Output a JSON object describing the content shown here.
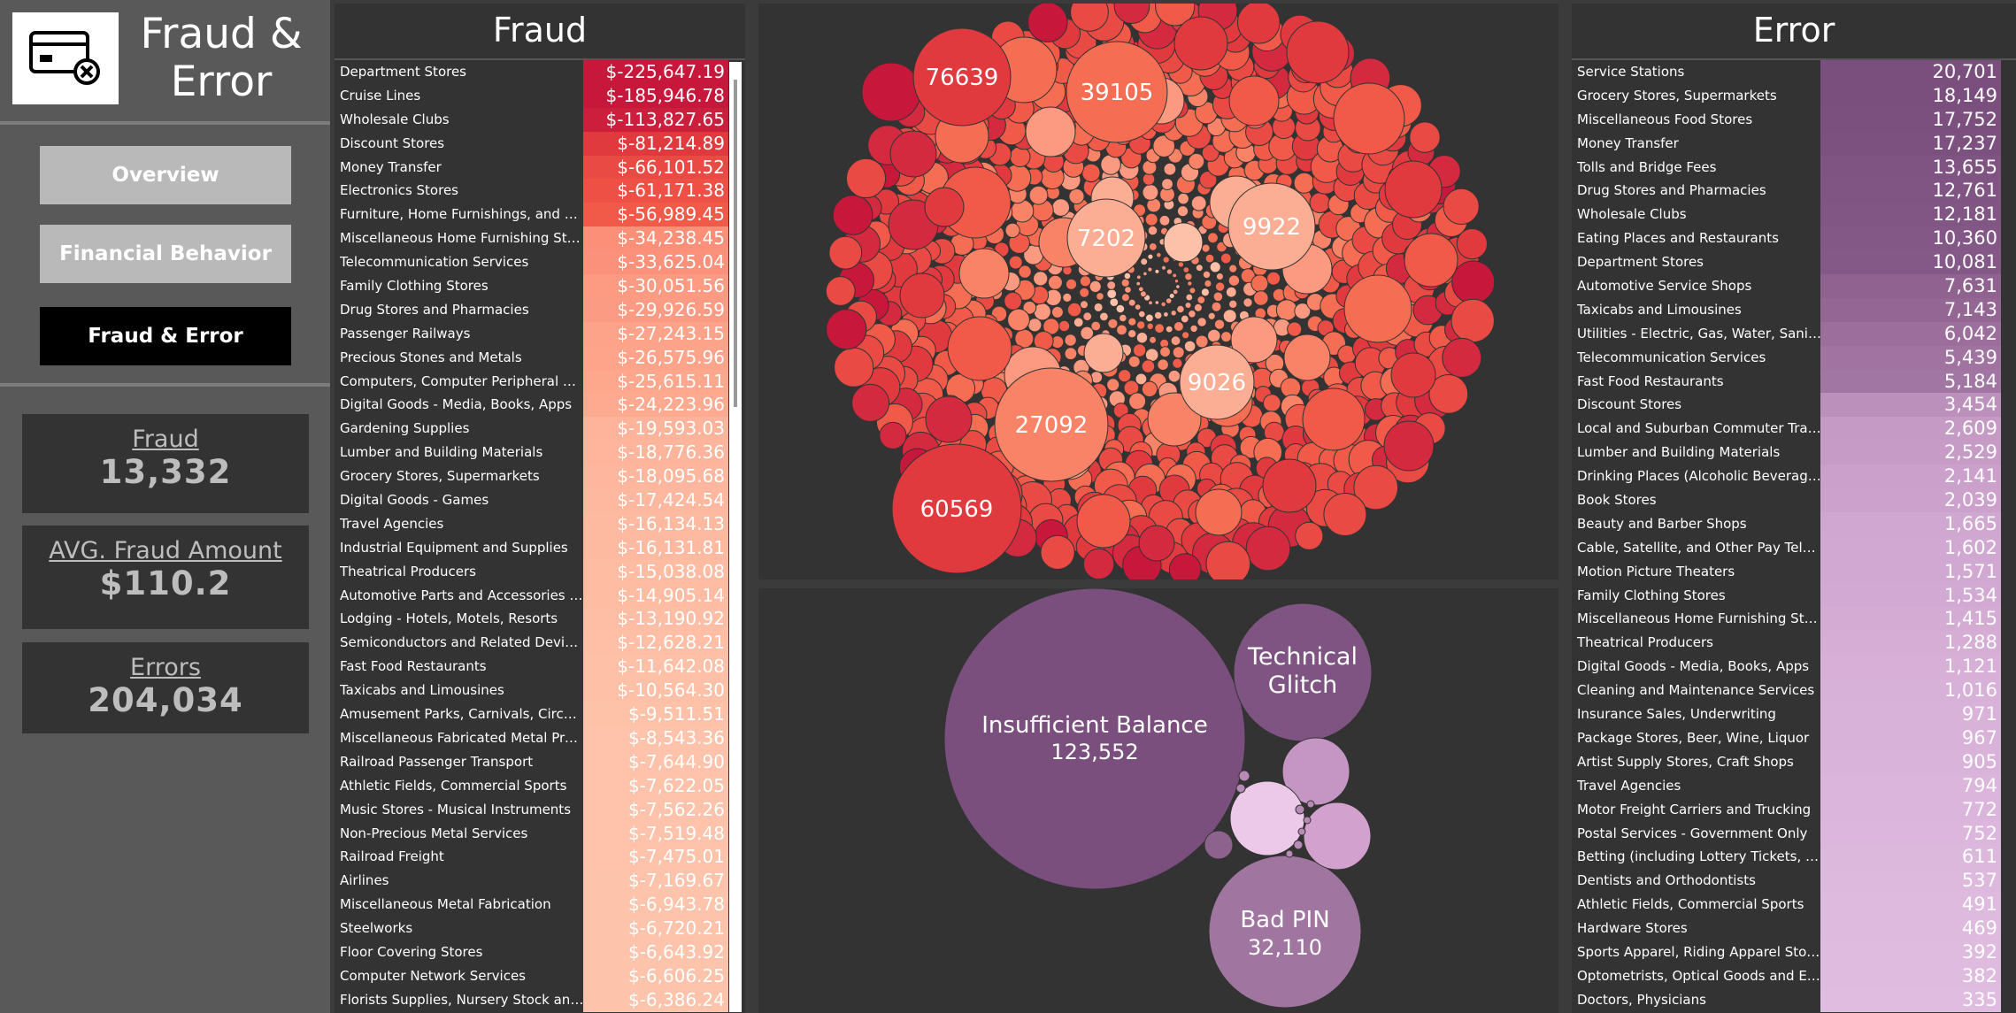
{
  "app": {
    "title_line1": "Fraud &",
    "title_line2": "Error"
  },
  "icons": {
    "logo": "credit-card-error-icon"
  },
  "nav": [
    {
      "label": "Overview",
      "active": false
    },
    {
      "label": "Financial Behavior",
      "active": false
    },
    {
      "label": "Fraud & Error",
      "active": true
    }
  ],
  "kpis": [
    {
      "label": "Fraud",
      "value": "13,332"
    },
    {
      "label": "AVG. Fraud Amount",
      "value": "$110.2"
    },
    {
      "label": "Errors",
      "value": "204,034"
    }
  ],
  "fraud_table": {
    "title": "Fraud",
    "rows": [
      {
        "name": "Department Stores",
        "value": "$-225,647.19",
        "color": "#c7183b"
      },
      {
        "name": "Cruise Lines",
        "value": "$-185,946.78",
        "color": "#c7183b"
      },
      {
        "name": "Wholesale Clubs",
        "value": "$-113,827.65",
        "color": "#cc1f3d"
      },
      {
        "name": "Discount Stores",
        "value": "$-81,214.89",
        "color": "#e03a3f"
      },
      {
        "name": "Money Transfer",
        "value": "$-66,101.52",
        "color": "#ea4a44"
      },
      {
        "name": "Electronics Stores",
        "value": "$-61,171.38",
        "color": "#ee5045"
      },
      {
        "name": "Furniture, Home Furnishings, and Equi..",
        "value": "$-56,989.45",
        "color": "#f15a48"
      },
      {
        "name": "Miscellaneous Home Furnishing Stores",
        "value": "$-34,238.45",
        "color": "#fb8f78"
      },
      {
        "name": "Telecommunication Services",
        "value": "$-33,625.04",
        "color": "#fb917a"
      },
      {
        "name": "Family Clothing Stores",
        "value": "$-30,051.56",
        "color": "#fc9a82"
      },
      {
        "name": "Drug Stores and Pharmacies",
        "value": "$-29,926.59",
        "color": "#fc9b83"
      },
      {
        "name": "Passenger Railways",
        "value": "$-27,243.15",
        "color": "#fda38a"
      },
      {
        "name": "Precious Stones and Metals",
        "value": "$-26,575.96",
        "color": "#fda48b"
      },
      {
        "name": "Computers, Computer Peripheral Equip..",
        "value": "$-25,615.11",
        "color": "#fda78d"
      },
      {
        "name": "Digital Goods - Media, Books, Apps",
        "value": "$-24,223.96",
        "color": "#fdaa90"
      },
      {
        "name": "Gardening Supplies",
        "value": "$-19,593.03",
        "color": "#feb49a"
      },
      {
        "name": "Lumber and Building Materials",
        "value": "$-18,776.36",
        "color": "#feb59c"
      },
      {
        "name": "Grocery Stores, Supermarkets",
        "value": "$-18,095.68",
        "color": "#feb79e"
      },
      {
        "name": "Digital Goods - Games",
        "value": "$-17,424.54",
        "color": "#feb89f"
      },
      {
        "name": "Travel Agencies",
        "value": "$-16,134.13",
        "color": "#feba a1"
      },
      {
        "name": "Industrial Equipment and Supplies",
        "value": "$-16,131.81",
        "color": "#febaa1"
      },
      {
        "name": "Theatrical Producers",
        "value": "$-15,038.08",
        "color": "#febca3"
      },
      {
        "name": "Automotive Parts and Accessories Stores",
        "value": "$-14,905.14",
        "color": "#febca3"
      },
      {
        "name": "Lodging - Hotels, Motels, Resorts",
        "value": "$-13,190.92",
        "color": "#febea5"
      },
      {
        "name": "Semiconductors and Related Devices",
        "value": "$-12,628.21",
        "color": "#febfa6"
      },
      {
        "name": "Fast Food Restaurants",
        "value": "$-11,642.08",
        "color": "#fec0a7"
      },
      {
        "name": "Taxicabs and Limousines",
        "value": "$-10,564.30",
        "color": "#fec1a8"
      },
      {
        "name": "Amusement Parks, Carnivals, Circuses",
        "value": "$-9,511.51",
        "color": "#fec2a9"
      },
      {
        "name": "Miscellaneous Fabricated Metal Products",
        "value": "$-8,543.36",
        "color": "#fec3aa"
      },
      {
        "name": "Railroad Passenger Transport",
        "value": "$-7,644.90",
        "color": "#fec3aa"
      },
      {
        "name": "Athletic Fields, Commercial Sports",
        "value": "$-7,622.05",
        "color": "#fec3aa"
      },
      {
        "name": "Music Stores - Musical Instruments",
        "value": "$-7,562.26",
        "color": "#fec3aa"
      },
      {
        "name": "Non-Precious Metal Services",
        "value": "$-7,519.48",
        "color": "#fec3aa"
      },
      {
        "name": "Railroad Freight",
        "value": "$-7,475.01",
        "color": "#fec3aa"
      },
      {
        "name": "Airlines",
        "value": "$-7,169.67",
        "color": "#fec4ab"
      },
      {
        "name": "Miscellaneous Metal Fabrication",
        "value": "$-6,943.78",
        "color": "#fec4ab"
      },
      {
        "name": "Steelworks",
        "value": "$-6,720.21",
        "color": "#fec4ab"
      },
      {
        "name": "Floor Covering Stores",
        "value": "$-6,643.92",
        "color": "#fec4ab"
      },
      {
        "name": "Computer Network Services",
        "value": "$-6,606.25",
        "color": "#fec4ab"
      },
      {
        "name": "Florists Supplies, Nursery Stock and Flo..",
        "value": "$-6,386.24",
        "color": "#fec4ab"
      }
    ]
  },
  "error_table": {
    "title": "Error",
    "rows": [
      {
        "name": "Service Stations",
        "value": "20,701",
        "color": "#7a4f7e"
      },
      {
        "name": "Grocery Stores, Supermarkets",
        "value": "18,149",
        "color": "#7a4f7e"
      },
      {
        "name": "Miscellaneous Food Stores",
        "value": "17,752",
        "color": "#7b507f"
      },
      {
        "name": "Money Transfer",
        "value": "17,237",
        "color": "#7c5180"
      },
      {
        "name": "Tolls and Bridge Fees",
        "value": "13,655",
        "color": "#7f5382"
      },
      {
        "name": "Drug Stores and Pharmacies",
        "value": "12,761",
        "color": "#805483"
      },
      {
        "name": "Wholesale Clubs",
        "value": "12,181",
        "color": "#815584"
      },
      {
        "name": "Eating Places and Restaurants",
        "value": "10,360",
        "color": "#835786"
      },
      {
        "name": "Department Stores",
        "value": "10,081",
        "color": "#845887"
      },
      {
        "name": "Automotive Service Shops",
        "value": "7,631",
        "color": "#8f628f"
      },
      {
        "name": "Taxicabs and Limousines",
        "value": "7,143",
        "color": "#936693"
      },
      {
        "name": "Utilities - Electric, Gas, Water, Sanitary",
        "value": "6,042",
        "color": "#9b6e9b"
      },
      {
        "name": "Telecommunication Services",
        "value": "5,439",
        "color": "#a073a0"
      },
      {
        "name": "Fast Food Restaurants",
        "value": "5,184",
        "color": "#a276a2"
      },
      {
        "name": "Discount Stores",
        "value": "3,454",
        "color": "#bb90bb"
      },
      {
        "name": "Local and Suburban Commuter Transpo..",
        "value": "2,609",
        "color": "#c59bc5"
      },
      {
        "name": "Lumber and Building Materials",
        "value": "2,529",
        "color": "#c69cc6"
      },
      {
        "name": "Drinking Places (Alcoholic Beverages)",
        "value": "2,141",
        "color": "#cba1cb"
      },
      {
        "name": "Book Stores",
        "value": "2,039",
        "color": "#cca2cc"
      },
      {
        "name": "Beauty and Barber Shops",
        "value": "1,665",
        "color": "#d0a7d0"
      },
      {
        "name": "Cable, Satellite, and Other Pay Televis..",
        "value": "1,602",
        "color": "#d1a8d1"
      },
      {
        "name": "Motion Picture Theaters",
        "value": "1,571",
        "color": "#d1a8d1"
      },
      {
        "name": "Family Clothing Stores",
        "value": "1,534",
        "color": "#d2a9d2"
      },
      {
        "name": "Miscellaneous Home Furnishing Stores",
        "value": "1,415",
        "color": "#d3abd3"
      },
      {
        "name": "Theatrical Producers",
        "value": "1,288",
        "color": "#d5add5"
      },
      {
        "name": "Digital Goods - Media, Books, Apps",
        "value": "1,121",
        "color": "#d7afd7"
      },
      {
        "name": "Cleaning and Maintenance Services",
        "value": "1,016",
        "color": "#d8b1d8"
      },
      {
        "name": "Insurance Sales, Underwriting",
        "value": "971",
        "color": "#d9b2d9"
      },
      {
        "name": "Package Stores, Beer, Wine, Liquor",
        "value": "967",
        "color": "#d9b2d9"
      },
      {
        "name": "Artist Supply Stores, Craft Shops",
        "value": "905",
        "color": "#dab3da"
      },
      {
        "name": "Travel Agencies",
        "value": "794",
        "color": "#dbb5db"
      },
      {
        "name": "Motor Freight Carriers and Trucking",
        "value": "772",
        "color": "#dbb5db"
      },
      {
        "name": "Postal Services - Government Only",
        "value": "752",
        "color": "#dcb6dc"
      },
      {
        "name": "Betting (including Lottery Tickets, Casi..",
        "value": "611",
        "color": "#ddb8dd"
      },
      {
        "name": "Dentists and Orthodontists",
        "value": "537",
        "color": "#deb9de"
      },
      {
        "name": "Athletic Fields, Commercial Sports",
        "value": "491",
        "color": "#dfbadf"
      },
      {
        "name": "Hardware Stores",
        "value": "469",
        "color": "#dfbadf"
      },
      {
        "name": "Sports Apparel, Riding Apparel Stores",
        "value": "392",
        "color": "#e0bbe0"
      },
      {
        "name": "Optometrists, Optical Goods and Eyegl..",
        "value": "382",
        "color": "#e0bbe0"
      },
      {
        "name": "Doctors, Physicians",
        "value": "335",
        "color": "#e1bce1"
      }
    ]
  },
  "fraud_bubbles": {
    "labels": [
      "76639",
      "39105",
      "7202",
      "9922",
      "9026",
      "27092",
      "60569"
    ]
  },
  "error_bubbles": {
    "items": [
      {
        "label": "Insufficient Balance",
        "value": "123,552"
      },
      {
        "label": "Technical",
        "label2": "Glitch"
      },
      {
        "label": "Bad PIN",
        "value": "32,110"
      }
    ]
  },
  "colors": {
    "fraud_dark": "#c7183b",
    "fraud_light": "#fec4ab",
    "error_dark": "#7a4f7e",
    "error_light": "#e1bce1",
    "panel_bg": "#333333"
  }
}
